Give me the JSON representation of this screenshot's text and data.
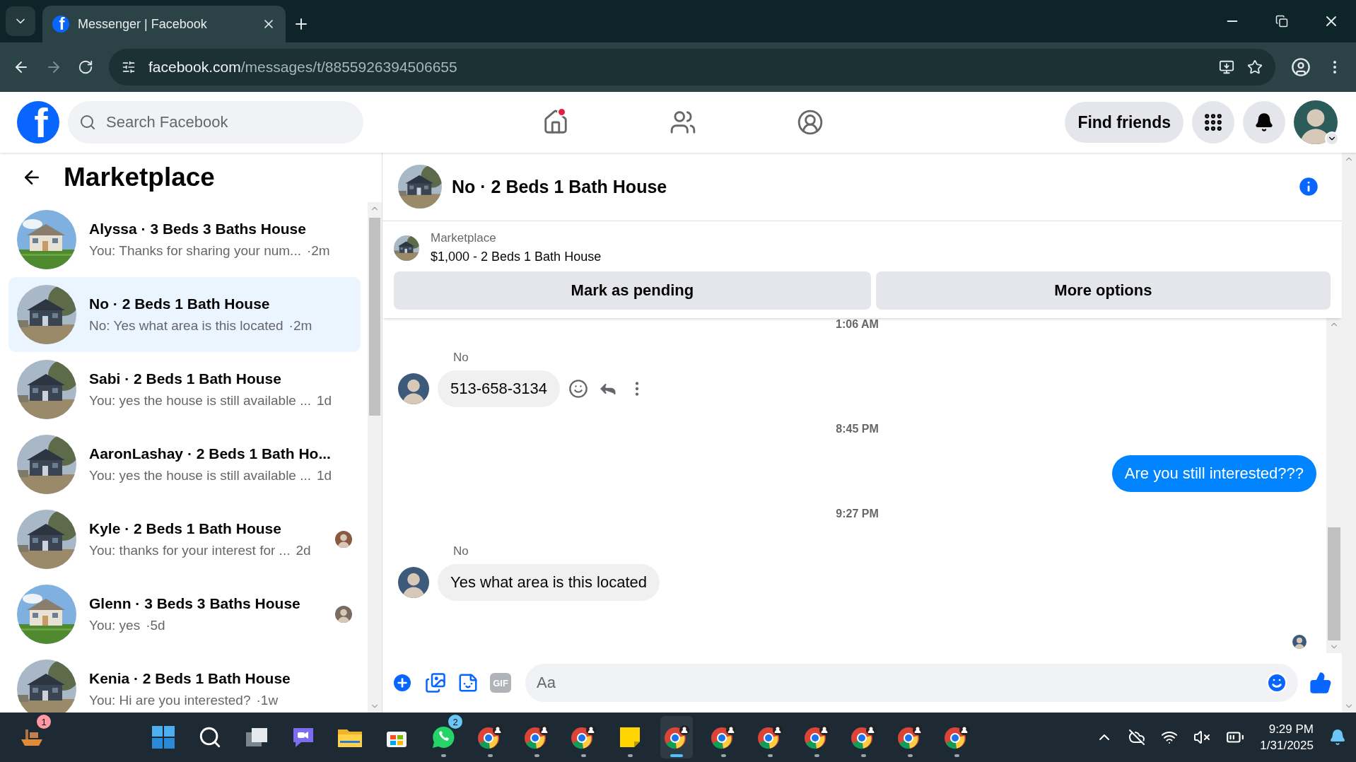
{
  "browser": {
    "favicon_letter": "f",
    "tab_title": "Messenger | Facebook",
    "url_host": "facebook.com",
    "url_path": "/messages/t/8855926394506655"
  },
  "header": {
    "logo_letter": "f",
    "search": {
      "placeholder": "Search Facebook"
    },
    "nav": [
      {
        "kind": "home",
        "has_notification": true
      },
      {
        "kind": "friends",
        "has_notification": false
      },
      {
        "kind": "profile",
        "has_notification": false
      }
    ],
    "find_friends": "Find friends"
  },
  "sidebar": {
    "title": "Marketplace",
    "conversations": [
      {
        "title": "Alyssa · 3 Beds 3 Baths House",
        "preview": "You: Thanks for sharing your num...",
        "time": "·2m",
        "selected": false,
        "seen_avatar": false
      },
      {
        "title": "No · 2 Beds 1 Bath House",
        "preview": "No: Yes what area is this located",
        "time": "·2m",
        "selected": true,
        "seen_avatar": false
      },
      {
        "title": "Sabi · 2 Beds 1 Bath House",
        "preview": "You: yes the house is still available ...",
        "time": "1d",
        "selected": false,
        "seen_avatar": false
      },
      {
        "title": "AaronLashay · 2 Beds 1 Bath Ho...",
        "preview": "You: yes the house is still available ...",
        "time": "1d",
        "selected": false,
        "seen_avatar": false
      },
      {
        "title": "Kyle · 2 Beds 1 Bath House",
        "preview": "You: thanks for your interest for ...",
        "time": "2d",
        "selected": false,
        "seen_avatar": true
      },
      {
        "title": "Glenn · 3 Beds 3 Baths House",
        "preview": "You: yes",
        "time": "·5d",
        "selected": false,
        "seen_avatar": true
      },
      {
        "title": "Kenia · 2 Beds 1 Bath House",
        "preview": "You: Hi are you interested?",
        "time": "·1w",
        "selected": false,
        "seen_avatar": false
      }
    ]
  },
  "chat": {
    "title": "No · 2 Beds 1 Bath House",
    "listing": {
      "label": "Marketplace",
      "price_title": "$1,000 - 2 Beds 1 Bath House",
      "buttons": [
        "Mark as pending",
        "More options"
      ]
    },
    "messages": [
      {
        "kind": "time",
        "text": "1:06 AM"
      },
      {
        "kind": "incoming",
        "sender": "No",
        "text": "513-658-3134",
        "actions_visible": true
      },
      {
        "kind": "time",
        "text": "8:45 PM"
      },
      {
        "kind": "outgoing",
        "text": "Are you still interested???"
      },
      {
        "kind": "time",
        "text": "9:27 PM"
      },
      {
        "kind": "incoming",
        "sender": "No",
        "text": "Yes what area is this located",
        "actions_visible": false
      }
    ],
    "seen_marker": true,
    "composer": {
      "placeholder": "Aa",
      "gif_label": "GIF"
    }
  },
  "taskbar": {
    "apps": [
      {
        "kind": "boat",
        "badge": "1",
        "running": false,
        "selected": false
      },
      {
        "kind": "start",
        "running": false,
        "selected": false
      },
      {
        "kind": "search",
        "running": false,
        "selected": false
      },
      {
        "kind": "taskview",
        "running": false,
        "selected": false
      },
      {
        "kind": "meet",
        "running": false,
        "selected": false
      },
      {
        "kind": "folder",
        "running": false,
        "selected": false
      },
      {
        "kind": "store",
        "running": false,
        "selected": false
      },
      {
        "kind": "chat",
        "badge": "2",
        "running": true,
        "selected": false
      },
      {
        "kind": "browser",
        "running": true,
        "selected": false
      },
      {
        "kind": "browser",
        "running": true,
        "selected": false
      },
      {
        "kind": "browser",
        "running": true,
        "selected": false
      },
      {
        "kind": "notes",
        "running": true,
        "selected": false
      },
      {
        "kind": "browser",
        "running": true,
        "selected": true
      },
      {
        "kind": "browser",
        "running": true,
        "selected": false
      },
      {
        "kind": "browser",
        "running": true,
        "selected": false
      },
      {
        "kind": "browser",
        "running": true,
        "selected": false
      },
      {
        "kind": "browser",
        "running": true,
        "selected": false
      },
      {
        "kind": "browser",
        "running": true,
        "selected": false
      },
      {
        "kind": "browser",
        "running": true,
        "selected": false
      }
    ],
    "time": "9:29 PM",
    "date": "1/31/2025"
  }
}
